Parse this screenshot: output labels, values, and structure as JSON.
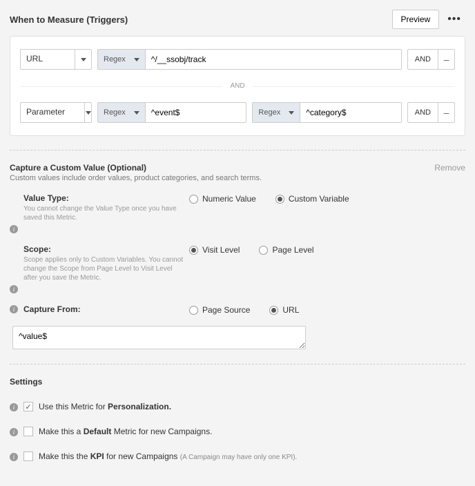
{
  "header": {
    "title": "When to Measure (Triggers)",
    "preview": "Preview"
  },
  "triggers": {
    "and_label": "AND",
    "row1": {
      "field": "URL",
      "match_type": "Regex",
      "pattern": "^/__ssobj/track",
      "and": "AND"
    },
    "row2": {
      "field": "Parameter",
      "match_type_a": "Regex",
      "pattern_a": "^event$",
      "match_type_b": "Regex",
      "pattern_b": "^category$",
      "and": "AND"
    }
  },
  "capture": {
    "title": "Capture a Custom Value (Optional)",
    "subtitle": "Custom values include order values, product categories, and search terms.",
    "remove": "Remove",
    "value_type": {
      "label": "Value Type:",
      "hint": "You cannot change the Value Type once you have saved this Metric.",
      "opts": {
        "numeric": "Numeric Value",
        "custom": "Custom Variable"
      }
    },
    "scope": {
      "label": "Scope:",
      "hint": "Scope applies only to Custom Variables. You cannot change the Scope from Page Level to Visit Level after you save the Metric.",
      "opts": {
        "visit": "Visit Level",
        "page": "Page Level"
      }
    },
    "capture_from": {
      "label": "Capture From:",
      "opts": {
        "source": "Page Source",
        "url": "URL"
      }
    },
    "expression": "^value$"
  },
  "settings": {
    "title": "Settings",
    "personalization_pre": "Use this Metric for ",
    "personalization_bold": "Personalization.",
    "default_pre": "Make this a ",
    "default_bold": "Default",
    "default_post": " Metric for new Campaigns.",
    "kpi_pre": "Make this the ",
    "kpi_bold": "KPI",
    "kpi_post": " for new Campaigns ",
    "kpi_paren": "(A Campaign may have only one KPI)."
  }
}
